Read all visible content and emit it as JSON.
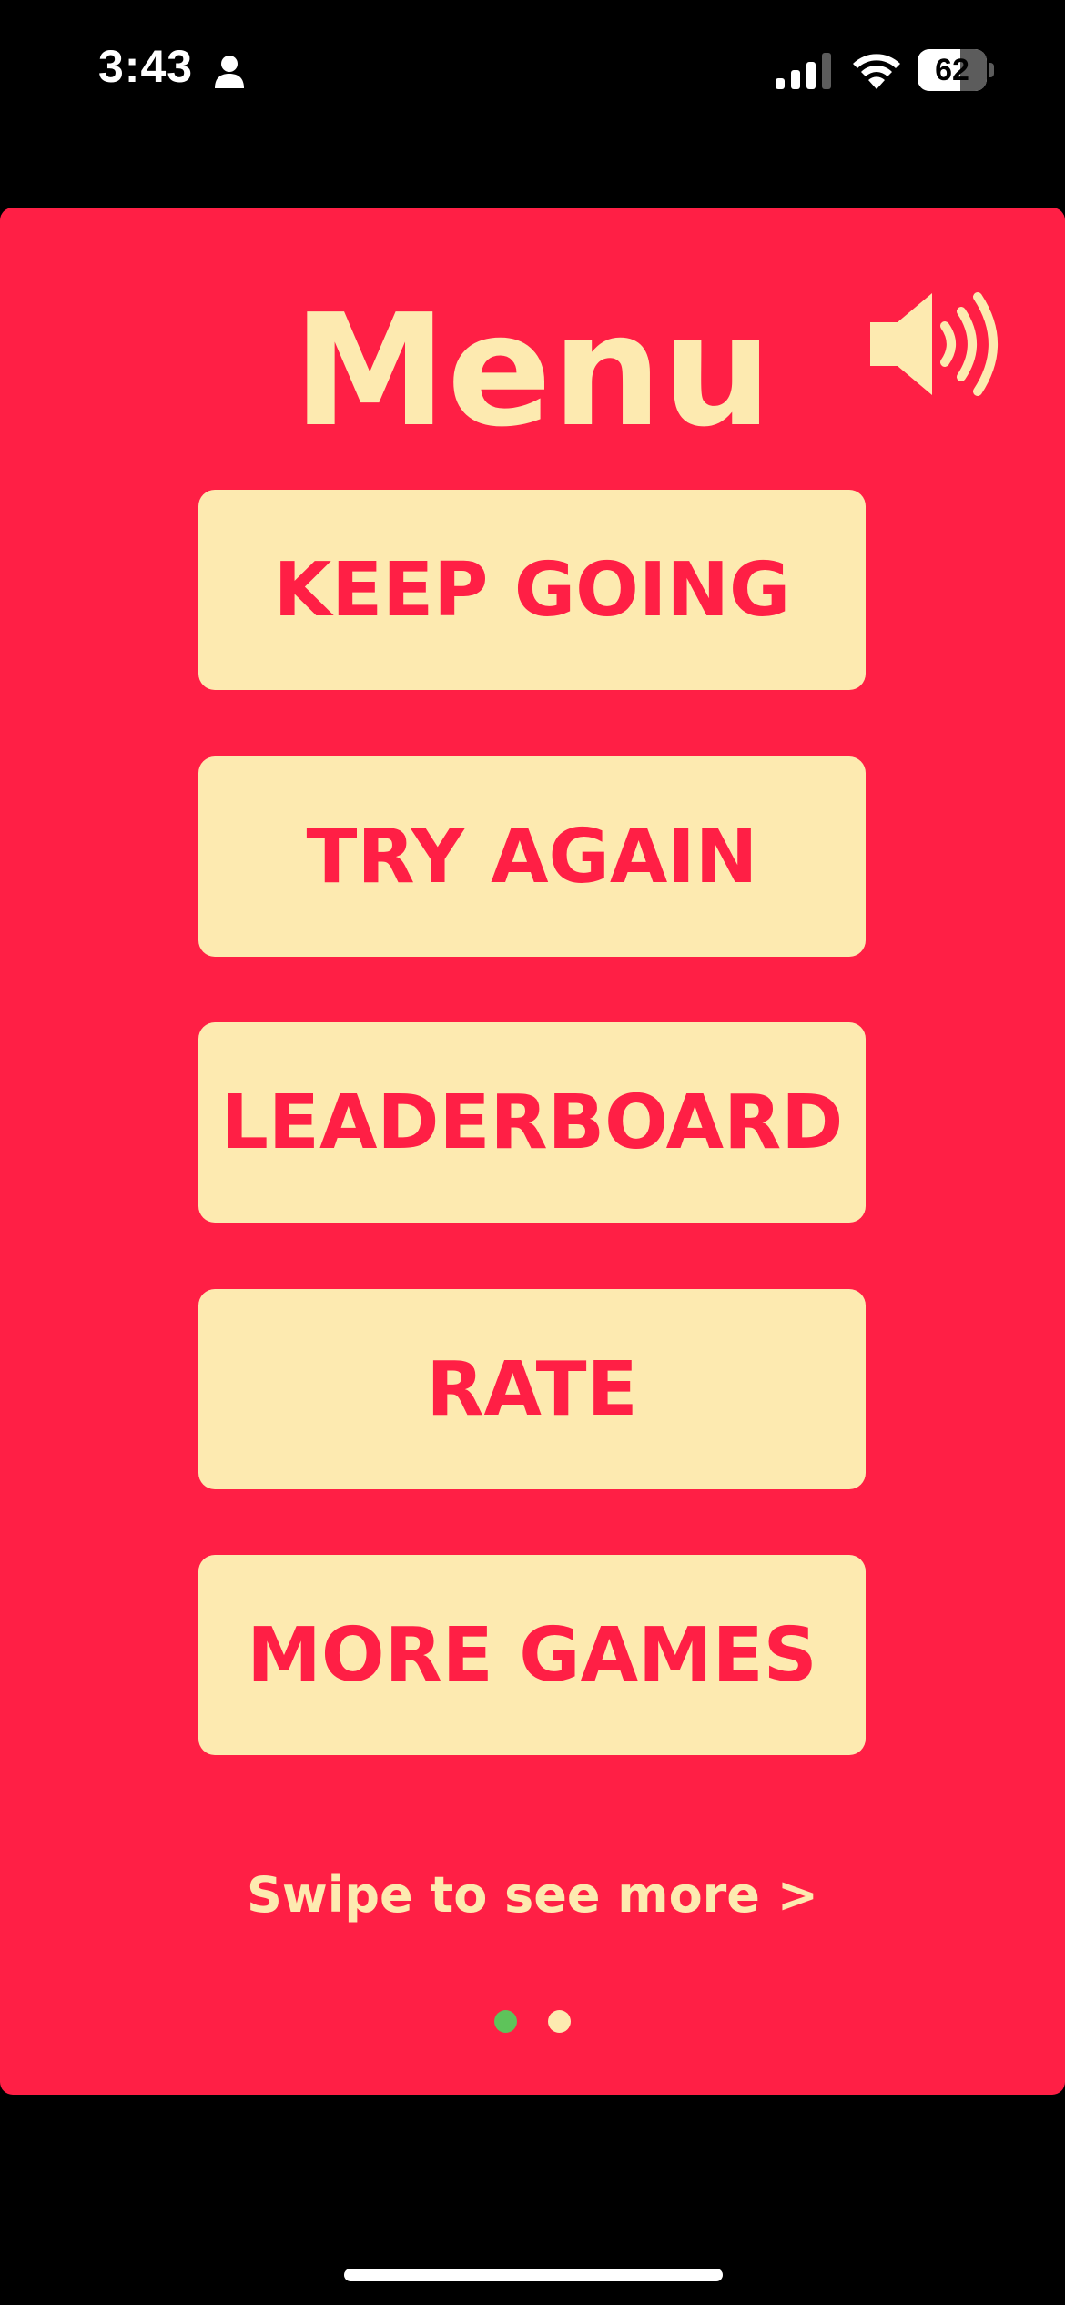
{
  "status_bar": {
    "time": "3:43",
    "battery_level": "62",
    "battery_fraction": 0.62,
    "person_icon": "person-icon",
    "signal_icon": "cellular-signal-icon",
    "wifi_icon": "wifi-icon"
  },
  "menu": {
    "title": "Menu",
    "sound_icon": "speaker-volume-icon",
    "buttons": [
      {
        "label": "KEEP GOING"
      },
      {
        "label": "TRY AGAIN"
      },
      {
        "label": "LEADERBOARD"
      },
      {
        "label": "RATE"
      },
      {
        "label": "MORE GAMES"
      }
    ],
    "swipe_hint": "Swipe to see more >",
    "page_indicator": {
      "pages": 2,
      "active": 1
    }
  },
  "colors": {
    "panel_background": "#ff1f45",
    "cream": "#fdeab0",
    "active_dot": "#5ec35a",
    "inactive_dot": "#fdeab0",
    "page_background": "#000000"
  }
}
